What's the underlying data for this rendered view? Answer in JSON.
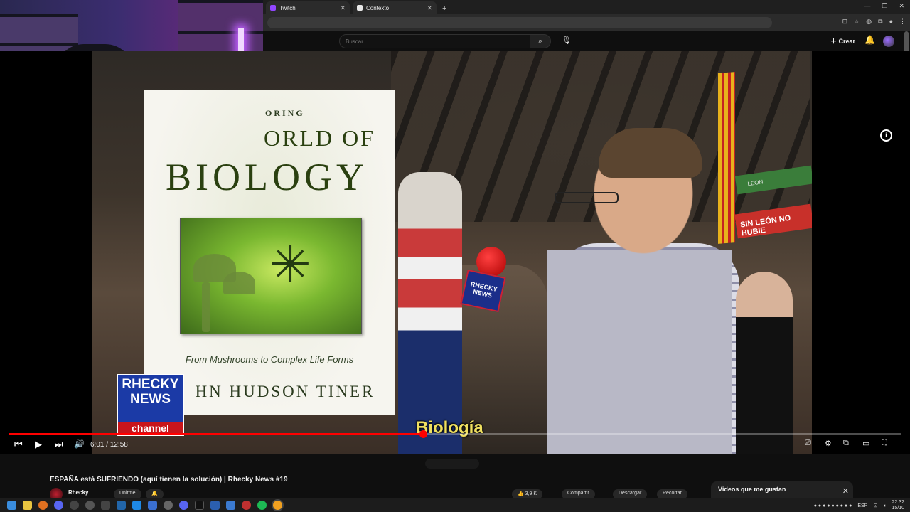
{
  "browser": {
    "tabs": [
      {
        "label": "Twitch",
        "favicon_color": "#9146ff"
      },
      {
        "label": "Contexto",
        "favicon_color": "#e8e8e8"
      }
    ],
    "new_tab": "+",
    "window_controls": [
      "—",
      "❐",
      "✕"
    ]
  },
  "youtube_header": {
    "search_placeholder": "Buscar",
    "search_icon": "search-icon",
    "mic_icon": "mic-icon",
    "create_label": "Crear",
    "bell_icon": "bell-icon"
  },
  "book": {
    "series_text": "ORING",
    "title_line1": "ORLD OF",
    "title_line2": "BIOLOGY",
    "subtitle": "From Mushrooms to Complex Life Forms",
    "author": "HN HUDSON TINER"
  },
  "scene": {
    "mic_label_1": "RHECKY",
    "mic_label_2": "NEWS",
    "banner_text": "SIN LEÓN NO HUBIE",
    "banner_green_text": "LEON"
  },
  "channel_logo": {
    "line1": "RHECKY",
    "line2": "NEWS",
    "line3": "channel"
  },
  "caption": "Biología",
  "player": {
    "current_time": "6:01",
    "separator": " / ",
    "duration": "12:58",
    "progress_fraction": 0.464,
    "accent": "#ff0000"
  },
  "video": {
    "title": "ESPAÑA está SUFRIENDO (aquí tienen la solución) | Rhecky News #19",
    "channel": "Rhecky",
    "join_label": "Unirme",
    "likes": "3,9 K",
    "share_label": "Compartir",
    "download_label": "Descargar",
    "clip_label": "Recortar"
  },
  "side_panel": {
    "title": "Videos que me gustan",
    "close": "✕"
  },
  "taskbar": {
    "language": "ESP",
    "time": "22:32",
    "date": "15/10"
  }
}
